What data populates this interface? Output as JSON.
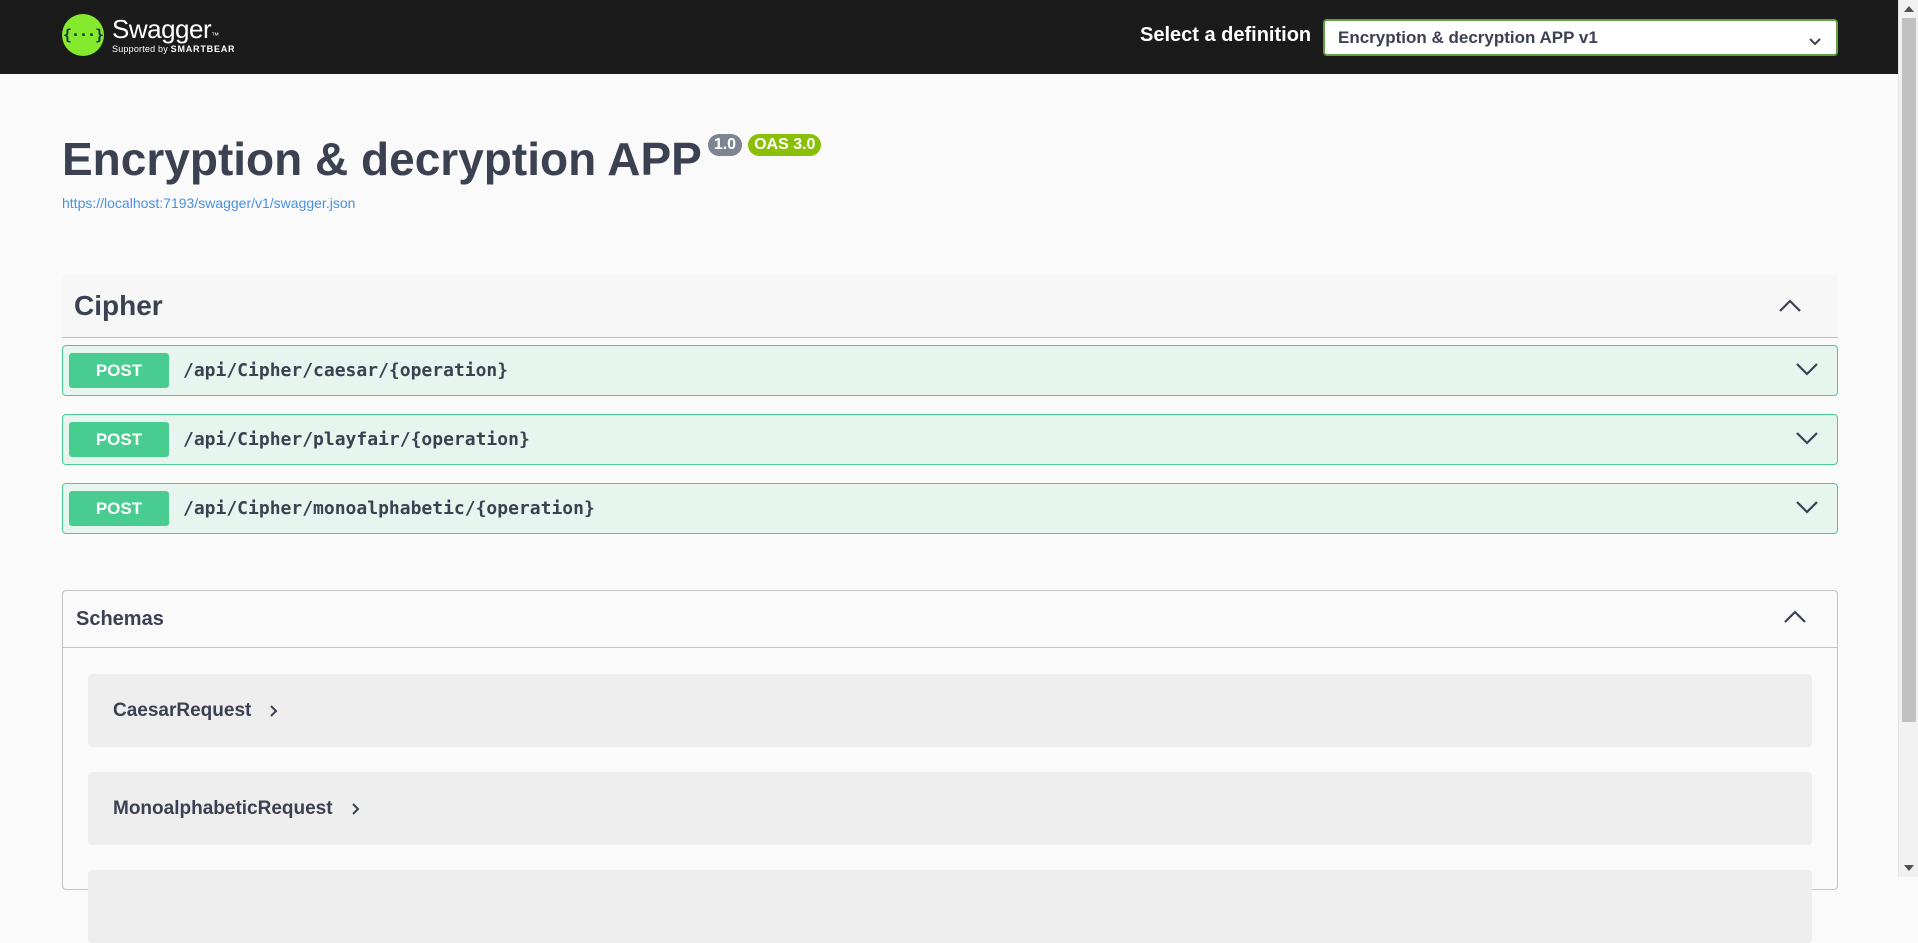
{
  "topbar": {
    "brand": "Swagger",
    "brand_tm": "™",
    "supported_prefix": "Supported by",
    "supported_brand": "SMARTBEAR",
    "logo_glyph": "{···}",
    "definition_label": "Select a definition",
    "definition_selected": "Encryption & decryption APP v1"
  },
  "info": {
    "title": "Encryption & decryption APP",
    "version": "1.0",
    "oas": "OAS 3.0",
    "url": "https://localhost:7193/swagger/v1/swagger.json"
  },
  "tag": {
    "name": "Cipher",
    "operations": [
      {
        "method": "POST",
        "path": "/api/Cipher/caesar/{operation}"
      },
      {
        "method": "POST",
        "path": "/api/Cipher/playfair/{operation}"
      },
      {
        "method": "POST",
        "path": "/api/Cipher/monoalphabetic/{operation}"
      }
    ]
  },
  "schemas": {
    "title": "Schemas",
    "models": [
      {
        "name": "CaesarRequest"
      },
      {
        "name": "MonoalphabeticRequest"
      }
    ]
  },
  "icons": {
    "collapse": "chevron-up-icon",
    "expand": "chevron-down-icon",
    "model_expand": "chevron-right-icon"
  },
  "colors": {
    "topbar": "#1b1b1b",
    "logo": "#85ea2d",
    "post": "#49cc90",
    "version_badge": "#7d8492",
    "oas_badge": "#89bf04",
    "link": "#4990e2"
  }
}
